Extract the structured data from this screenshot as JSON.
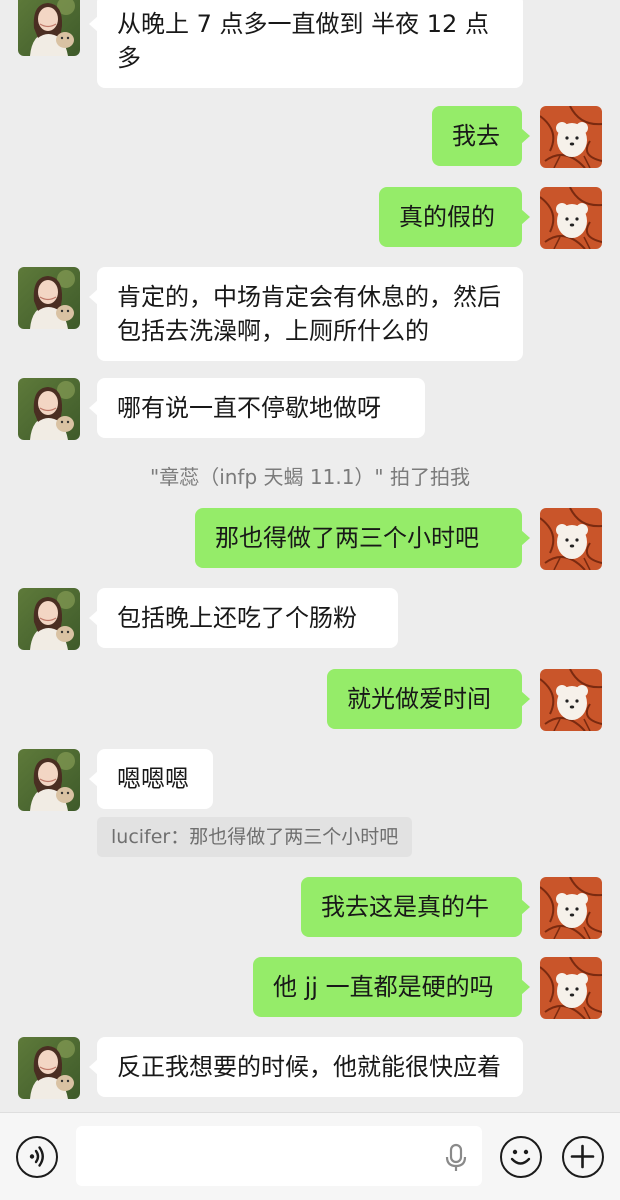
{
  "messages": [
    {
      "side": "left",
      "text": "从晚上 7 点多一直做到 半夜 12 点多"
    },
    {
      "side": "right",
      "text": "我去"
    },
    {
      "side": "right",
      "text": "真的假的"
    },
    {
      "side": "left",
      "text": "肯定的，中场肯定会有休息的，然后包括去洗澡啊，上厕所什么的"
    },
    {
      "side": "left",
      "text": "哪有说一直不停歇地做呀"
    },
    {
      "side": "system",
      "text": "\"章蕊（infp 天蝎 11.1）\" 拍了拍我"
    },
    {
      "side": "right",
      "text": "那也得做了两三个小时吧"
    },
    {
      "side": "left",
      "text": "包括晚上还吃了个肠粉"
    },
    {
      "side": "right",
      "text": "就光做爱时间"
    },
    {
      "side": "left",
      "text": "嗯嗯嗯"
    },
    {
      "side": "quote",
      "text": "lucifer：那也得做了两三个小时吧"
    },
    {
      "side": "right",
      "text": "我去这是真的牛"
    },
    {
      "side": "right",
      "text": "他 jj 一直都是硬的吗"
    },
    {
      "side": "left",
      "text": "反正我想要的时候，他就能很快应着"
    }
  ],
  "input_bar": {
    "voice_icon": "voice-icon",
    "input_placeholder": "",
    "mic_icon": "mic-icon",
    "emoji_icon": "emoji-icon",
    "plus_icon": "plus-icon"
  },
  "colors": {
    "background": "#ededed",
    "bubble_sent": "#95ec69",
    "bubble_received": "#ffffff",
    "system_text": "#7b7b7b"
  }
}
